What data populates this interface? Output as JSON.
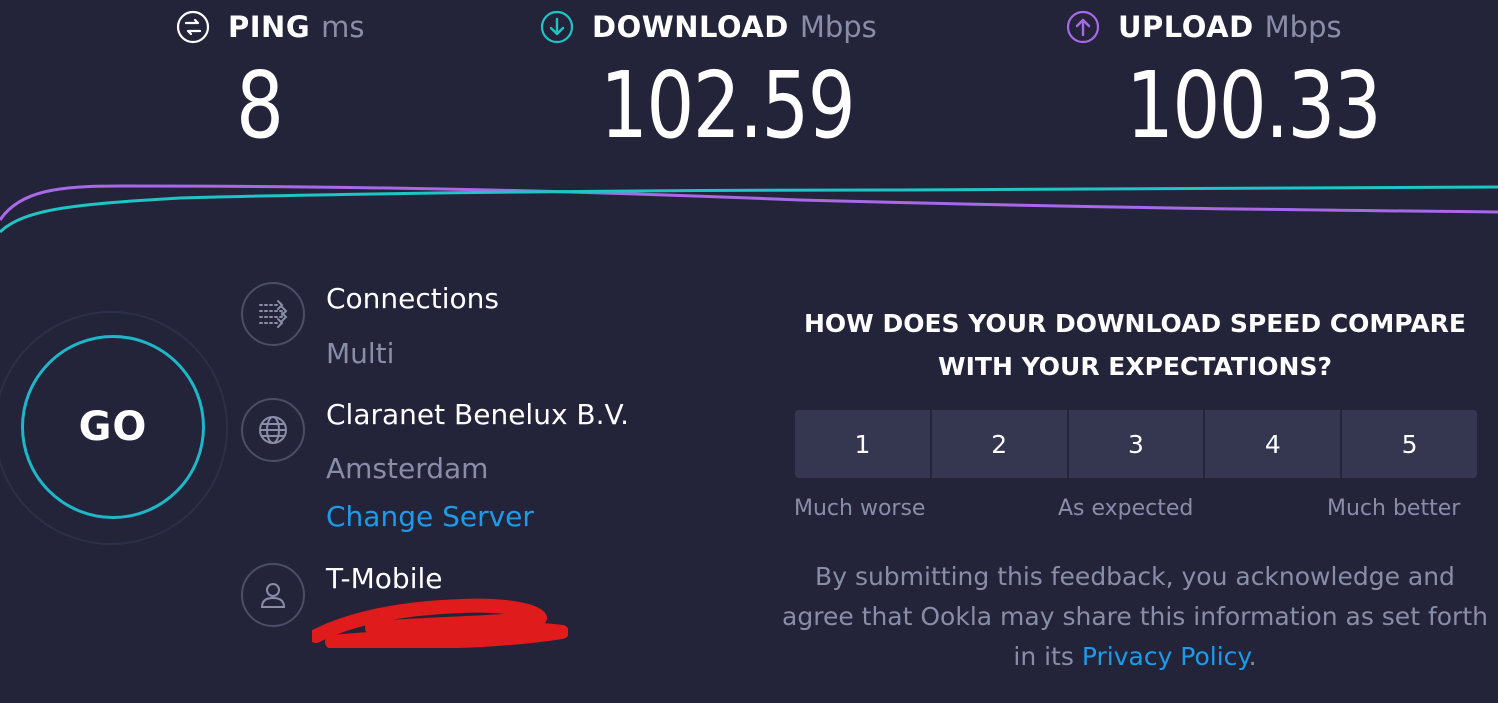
{
  "metrics": {
    "ping": {
      "label": "PING",
      "unit": "ms",
      "value": "8",
      "icon": "ping-icon"
    },
    "download": {
      "label": "DOWNLOAD",
      "unit": "Mbps",
      "value": "102.59",
      "icon": "arrow-down-circle-icon",
      "color": "#1fc4c4"
    },
    "upload": {
      "label": "UPLOAD",
      "unit": "Mbps",
      "value": "100.33",
      "icon": "arrow-up-circle-icon",
      "color": "#a869e8"
    }
  },
  "go": {
    "label": "GO",
    "ring_color": "#1fb7c8"
  },
  "connections": {
    "title": "Connections",
    "value": "Multi",
    "icon": "connections-icon"
  },
  "server": {
    "name": "Claranet Benelux B.V.",
    "location": "Amsterdam",
    "change_label": "Change Server",
    "icon": "globe-icon"
  },
  "provider": {
    "name": "T-Mobile",
    "icon": "user-icon",
    "redaction_color": "#e01b1b"
  },
  "feedback": {
    "question": "HOW DOES YOUR DOWNLOAD SPEED COMPARE WITH YOUR EXPECTATIONS?",
    "ratings": [
      "1",
      "2",
      "3",
      "4",
      "5"
    ],
    "scale": {
      "low": "Much worse",
      "mid": "As expected",
      "high": "Much better"
    },
    "disclaimer": "By submitting this feedback, you acknowledge and agree that Ookla may share this information as set forth in its",
    "privacy_link": "Privacy Policy",
    "period": "."
  },
  "colors": {
    "background": "#23243a",
    "link": "#1e9be8",
    "muted": "#8a8da8"
  }
}
